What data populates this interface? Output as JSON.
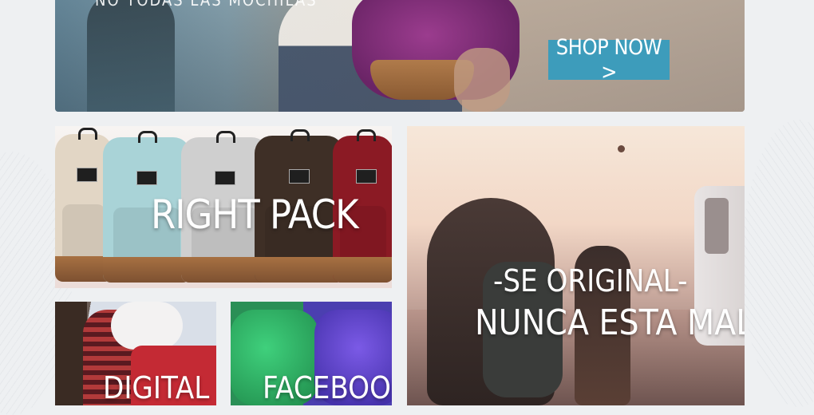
{
  "hero": {
    "headline_partial": "NO TODAS LAS MOCHILAS",
    "shop_button": "SHOP NOW >"
  },
  "tiles": {
    "right_pack": "RIGHT PACK",
    "digital": "DIGITAL",
    "facebook": "FACEBOOK",
    "original_line1": "-SE ORIGINAL-",
    "original_line2": "NUNCA ESTA MAL"
  },
  "colors": {
    "shop_button": "#3d9cbb",
    "background": "#eef0f2"
  }
}
